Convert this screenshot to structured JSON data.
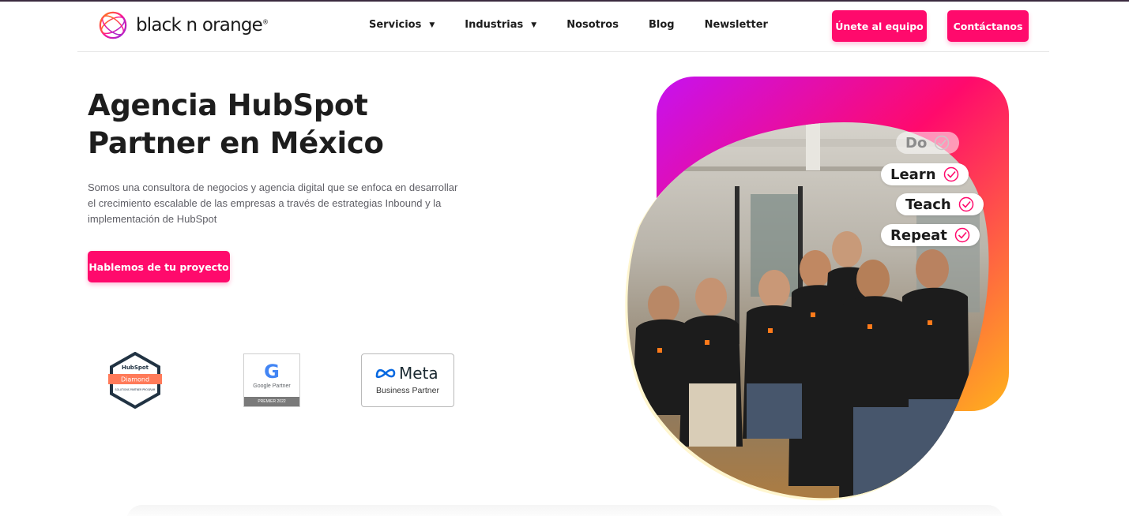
{
  "header": {
    "logo_text": "black n orange",
    "logo_reg": "®",
    "nav": [
      {
        "label": "Servicios",
        "caret": "▼"
      },
      {
        "label": "Industrias",
        "caret": "▼"
      },
      {
        "label": "Nosotros"
      },
      {
        "label": "Blog"
      },
      {
        "label": "Newsletter"
      }
    ],
    "join_label": "Únete al equipo",
    "contact_label": "Contáctanos"
  },
  "hero": {
    "title_line1": "Agencia HubSpot",
    "title_line2": "Partner en México",
    "description": "Somos una consultora de negocios y agencia digital que se enfoca en desarrollar el crecimiento escalable de las empresas a través de estrategias Inbound y la implementación de HubSpot",
    "cta_label": "Hablemos de tu proyecto"
  },
  "badges": {
    "hubspot": {
      "brand": "HubSpot",
      "tier": "Diamond",
      "line": "SOLUTIONS PARTNER PROGRAM"
    },
    "google": {
      "letter": "G",
      "text": "Google Partner",
      "footer": "PREMIER 2022"
    },
    "meta": {
      "word": "Meta",
      "sub": "Business Partner"
    }
  },
  "pills": [
    "Do",
    "Learn",
    "Teach",
    "Repeat"
  ],
  "colors": {
    "accent": "#ff0a6c",
    "gradient_start": "#c612f0",
    "gradient_mid": "#ff0a6c",
    "gradient_end": "#ffb21c"
  }
}
